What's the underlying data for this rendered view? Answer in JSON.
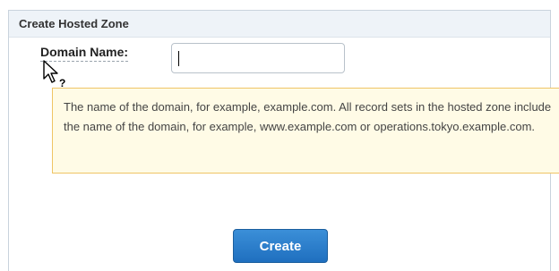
{
  "panel": {
    "title": "Create Hosted Zone"
  },
  "form": {
    "domain_label": "Domain Name:",
    "domain_value": "",
    "domain_placeholder": ""
  },
  "tooltip": {
    "text": "The name of the domain, for example, example.com. All record sets in the hosted zone include the name of the domain, for example, www.example.com or operations.tokyo.example.com."
  },
  "actions": {
    "create_label": "Create"
  },
  "colors": {
    "header_bg": "#eef3f8",
    "tooltip_bg": "#fffbe6",
    "tooltip_border": "#efc465",
    "button_bg": "#2a7ccb"
  },
  "icons": {
    "cursor": "help-cursor-icon"
  }
}
